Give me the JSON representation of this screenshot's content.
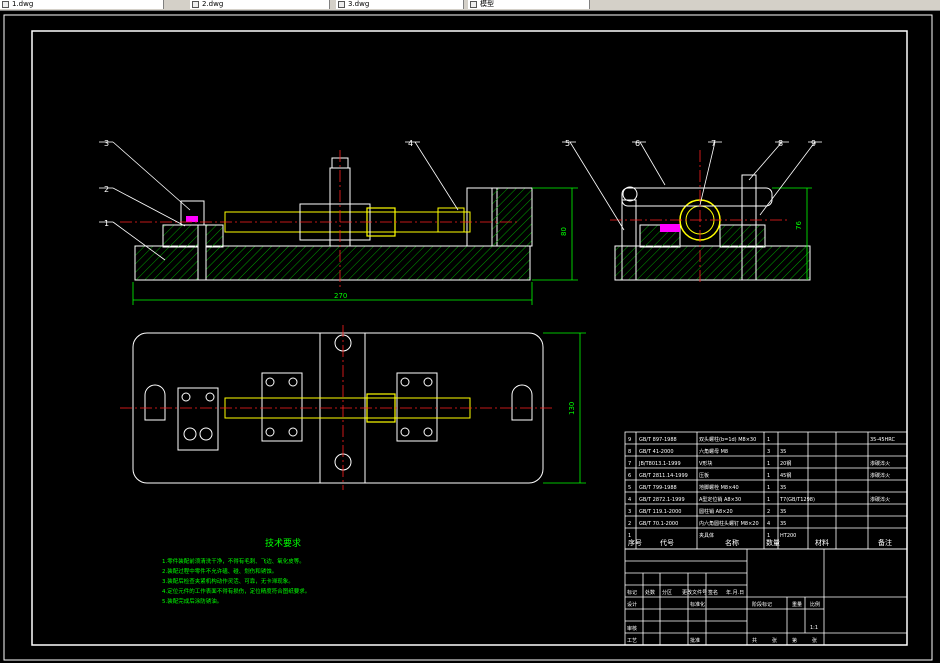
{
  "tabs": [
    {
      "label": "1.dwg"
    },
    {
      "label": "2.dwg"
    },
    {
      "label": "3.dwg"
    },
    {
      "label": "模型"
    }
  ],
  "colors": {
    "background": "#000000",
    "outline": "#ffffff",
    "hatch": "#00a000",
    "center_line": "#ff2020",
    "dimension": "#00ff00",
    "part_yellow": "#ffff00",
    "part_magenta": "#ff00ff"
  },
  "drawing": {
    "balloons": [
      "1",
      "2",
      "3",
      "4",
      "5",
      "6",
      "7",
      "8",
      "9"
    ],
    "dim_overall_length": "270",
    "dim_height_front": "80",
    "dim_height_side": "76",
    "dim_width_top": "130"
  },
  "tech_requirements": {
    "title": "技术要求",
    "lines": [
      "1.零件装配前须清洗干净，不得有毛刺、飞边、氧化皮等。",
      "2.装配过程中零件不允许磕、碰、划伤和锈蚀。",
      "3.装配后检查夹紧机构动作灵活、可靠，无卡滞现象。",
      "4.定位元件的工作表面不得有损伤，定位精度符合图纸要求。",
      "5.装配完成后涂防锈油。"
    ]
  },
  "bom": {
    "rows": [
      {
        "no": "9",
        "code": "GB/T 897-1988",
        "name": "双头螺柱(b=1d) M8×30",
        "qty": "1",
        "material": "",
        "note": "35-45HRC"
      },
      {
        "no": "8",
        "code": "GB/T 41-2000",
        "name": "六角螺母 M8",
        "qty": "3",
        "material": "35",
        "note": ""
      },
      {
        "no": "7",
        "code": "JB/T8013.1-1999",
        "name": "V形块",
        "qty": "1",
        "material": "20钢",
        "note": "渗碳淬火"
      },
      {
        "no": "6",
        "code": "GB/T 2811.14-1999",
        "name": "压板",
        "qty": "1",
        "material": "45钢",
        "note": "渗碳淬火"
      },
      {
        "no": "5",
        "code": "GB/T 799-1988",
        "name": "地脚螺栓 M8×40",
        "qty": "1",
        "material": "35",
        "note": ""
      },
      {
        "no": "4",
        "code": "GB/T 2872.1-1999",
        "name": "A型定位销 A8×30",
        "qty": "1",
        "material": "T7(GB/T1298)",
        "note": "渗碳淬火"
      },
      {
        "no": "3",
        "code": "GB/T 119.1-2000",
        "name": "圆柱销 A8×20",
        "qty": "2",
        "material": "35",
        "note": ""
      },
      {
        "no": "2",
        "code": "GB/T 70.1-2000",
        "name": "内六角圆柱头螺钉 M8×20",
        "qty": "4",
        "material": "35",
        "note": ""
      },
      {
        "no": "1",
        "code": "",
        "name": "夹具体",
        "qty": "1",
        "material": "HT200",
        "note": ""
      }
    ],
    "headers": {
      "no": "序号",
      "code": "代号",
      "name": "名称",
      "qty": "数量",
      "material": "材料",
      "single": "单件",
      "total": "总计",
      "weight": "重量",
      "note": "备注"
    }
  },
  "title_block": {
    "mark": "标记",
    "count": "处数",
    "zone": "分区",
    "doc_no": "更改文件号",
    "sign": "签名",
    "date": "年.月.日",
    "design": "设计",
    "standardize": "标准化",
    "review": "审核",
    "process": "工艺",
    "approve": "批准",
    "stage_mark": "阶段标记",
    "weight": "重量",
    "scale": "比例",
    "scale_value": "1:1",
    "sheets": "共",
    "sheet_label": "张",
    "page": "第",
    "page_label": "张"
  }
}
